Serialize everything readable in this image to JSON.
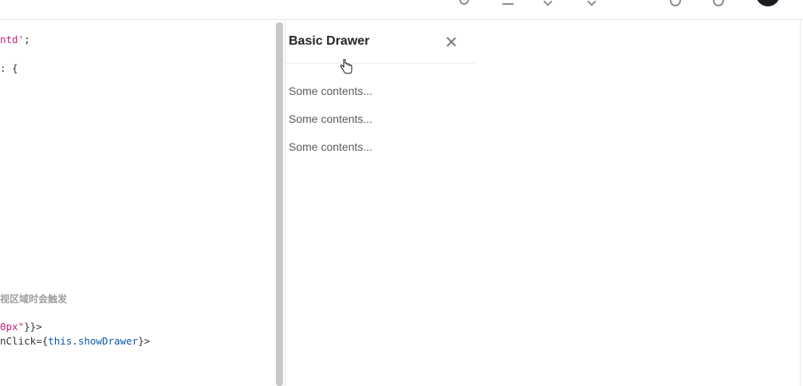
{
  "code": {
    "lines": [
      {
        "pre": "",
        "str": "ntd'",
        "post": ";"
      },
      {
        "pre": ": {",
        "str": "",
        "post": ""
      },
      {
        "comment": "视区域时会触发"
      },
      {
        "pre": "",
        "str": "0px\"",
        "post": "}}>"
      },
      {
        "pre": "nClick={",
        "kw1": "this",
        "dot": ".",
        "kw2": "showDrawer",
        "post": "}>"
      }
    ]
  },
  "drawer": {
    "title": "Basic Drawer",
    "contents": [
      "Some contents...",
      "Some contents...",
      "Some contents..."
    ]
  },
  "colors": {
    "string": "#c41d7f",
    "keyword": "#0b59a5",
    "border": "#e8e8e8"
  },
  "icons": [
    "search-icon",
    "edit-icon",
    "chevron-down-icon",
    "chevron-down-icon",
    "github-icon",
    "settings-icon",
    "avatar",
    "close-icon",
    "hand-cursor-icon"
  ]
}
